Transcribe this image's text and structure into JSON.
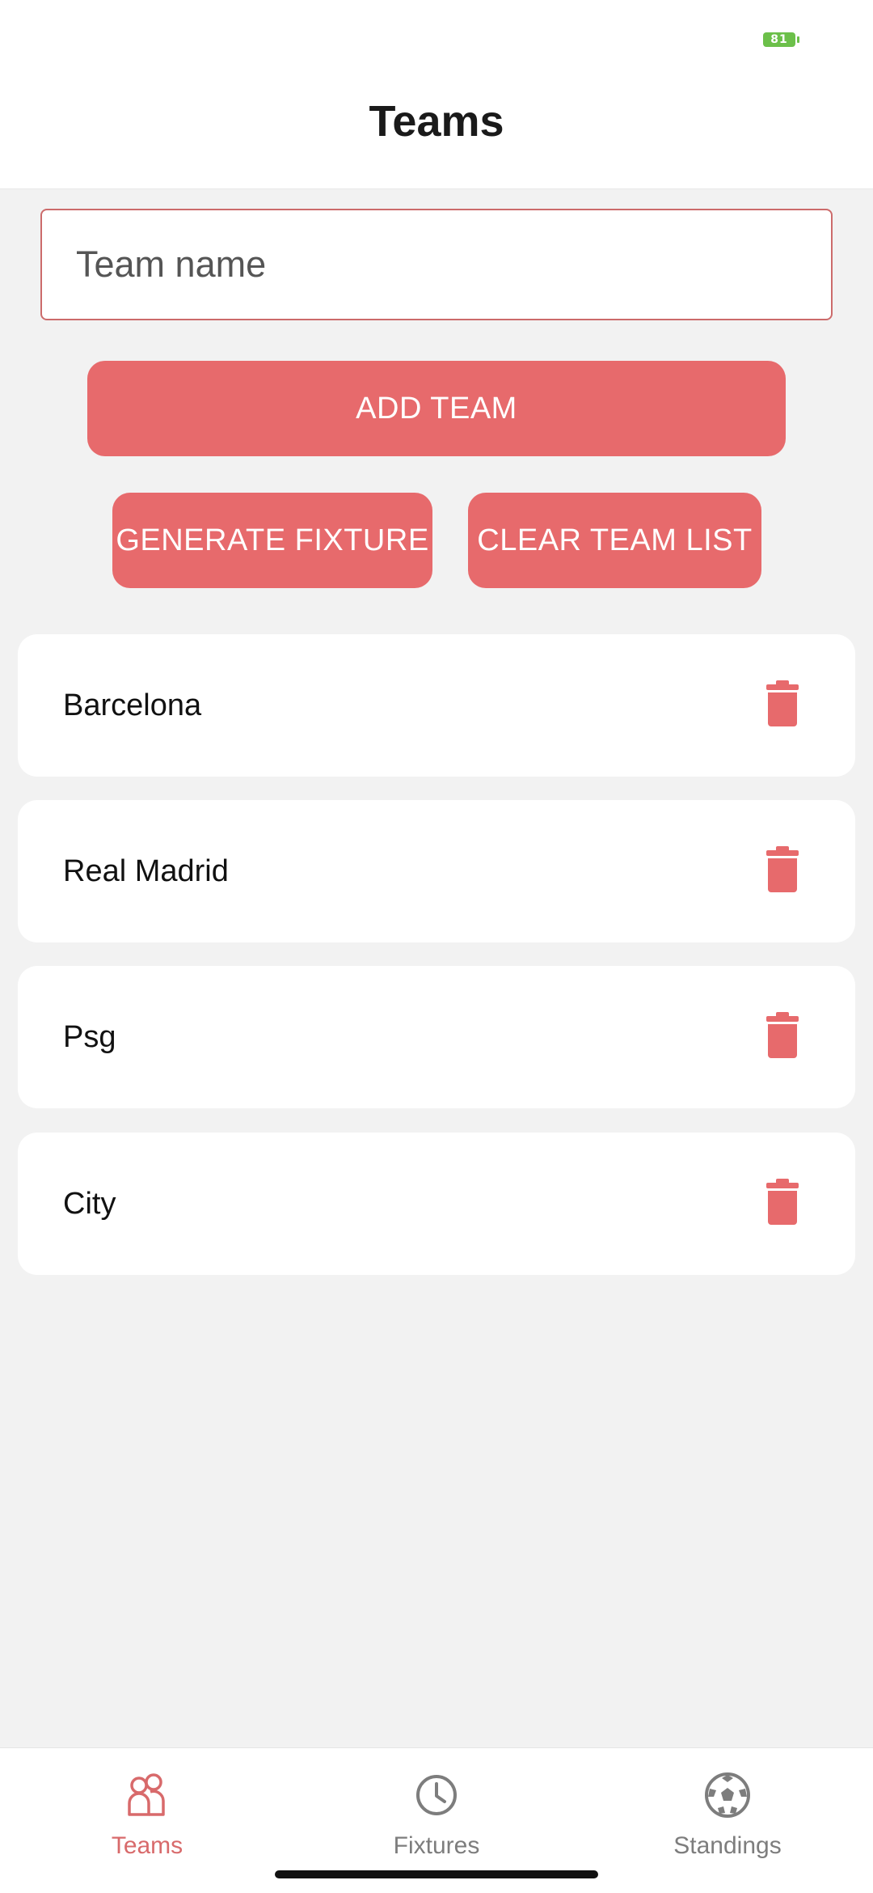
{
  "status": {
    "battery": "81"
  },
  "header": {
    "title": "Teams"
  },
  "input": {
    "placeholder": "Team name",
    "value": ""
  },
  "buttons": {
    "add": "ADD TEAM",
    "generate": "GENERATE FIXTURE",
    "clear": "CLEAR TEAM LIST"
  },
  "teams": [
    {
      "name": "Barcelona"
    },
    {
      "name": "Real Madrid"
    },
    {
      "name": "Psg"
    },
    {
      "name": "City"
    }
  ],
  "nav": {
    "items": [
      {
        "label": "Teams",
        "icon": "people-icon",
        "active": true
      },
      {
        "label": "Fixtures",
        "icon": "clock-icon",
        "active": false
      },
      {
        "label": "Standings",
        "icon": "soccer-ball-icon",
        "active": false
      }
    ]
  },
  "colors": {
    "accent": "#e76a6c",
    "nav_active": "#d86a6b",
    "nav_inactive": "#7d7d7d",
    "battery": "#6cc04a",
    "background": "#f2f2f2"
  }
}
